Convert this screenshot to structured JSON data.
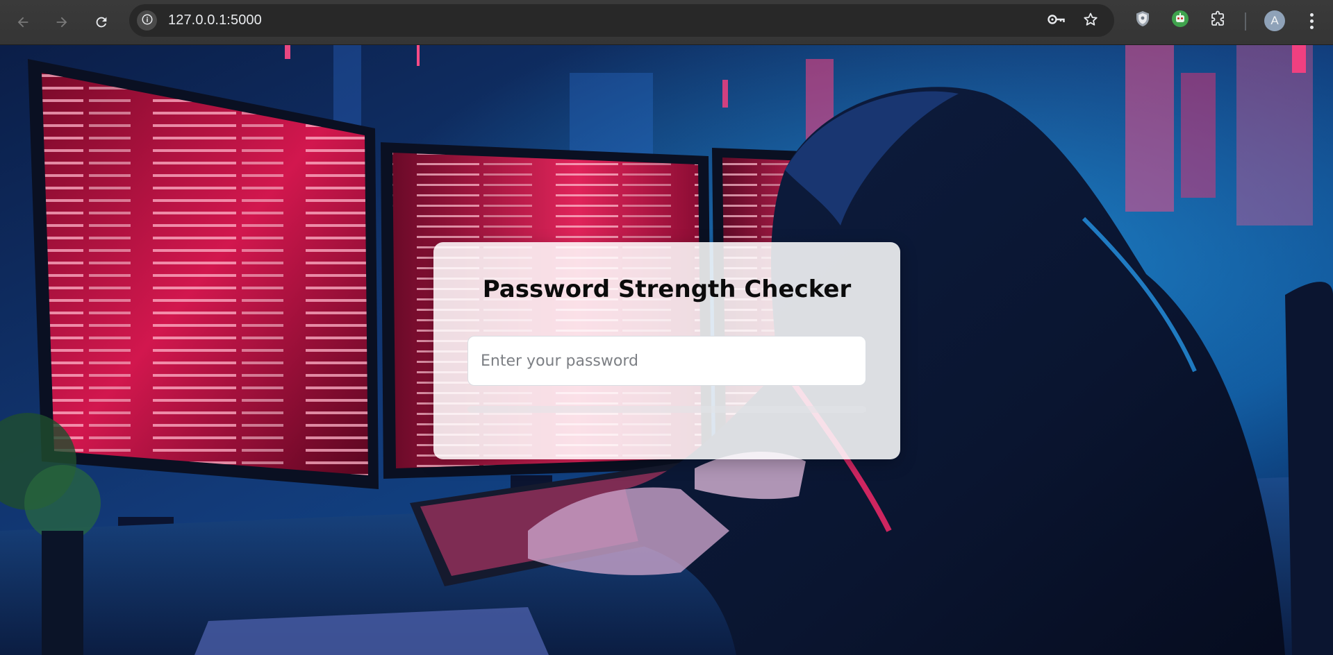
{
  "browser": {
    "url": "127.0.0.1:5000",
    "profile_initial": "A",
    "icons": {
      "back": "arrow-left-icon",
      "forward": "arrow-right-icon",
      "reload": "reload-icon",
      "site_info": "info-icon",
      "password_manager": "key-icon",
      "bookmark": "star-icon",
      "extension_1": "shield-icon",
      "extension_2": "robot-icon",
      "extensions": "puzzle-icon",
      "menu": "kebab-menu-icon"
    }
  },
  "page": {
    "background_image": "hooded hacker typing at glowing red code monitors, neon blue and pink cyber city backdrop",
    "card": {
      "title": "Password Strength Checker",
      "password_placeholder": "Enter your password",
      "password_value": "",
      "strength_fraction": 0
    }
  },
  "colors": {
    "chrome_bg": "#353535",
    "omnibox_bg": "#282828",
    "card_bg": "#ffffff",
    "title_text": "#0b0b0b",
    "accent_red": "#ff2a6d",
    "accent_blue": "#1aa8ff"
  }
}
